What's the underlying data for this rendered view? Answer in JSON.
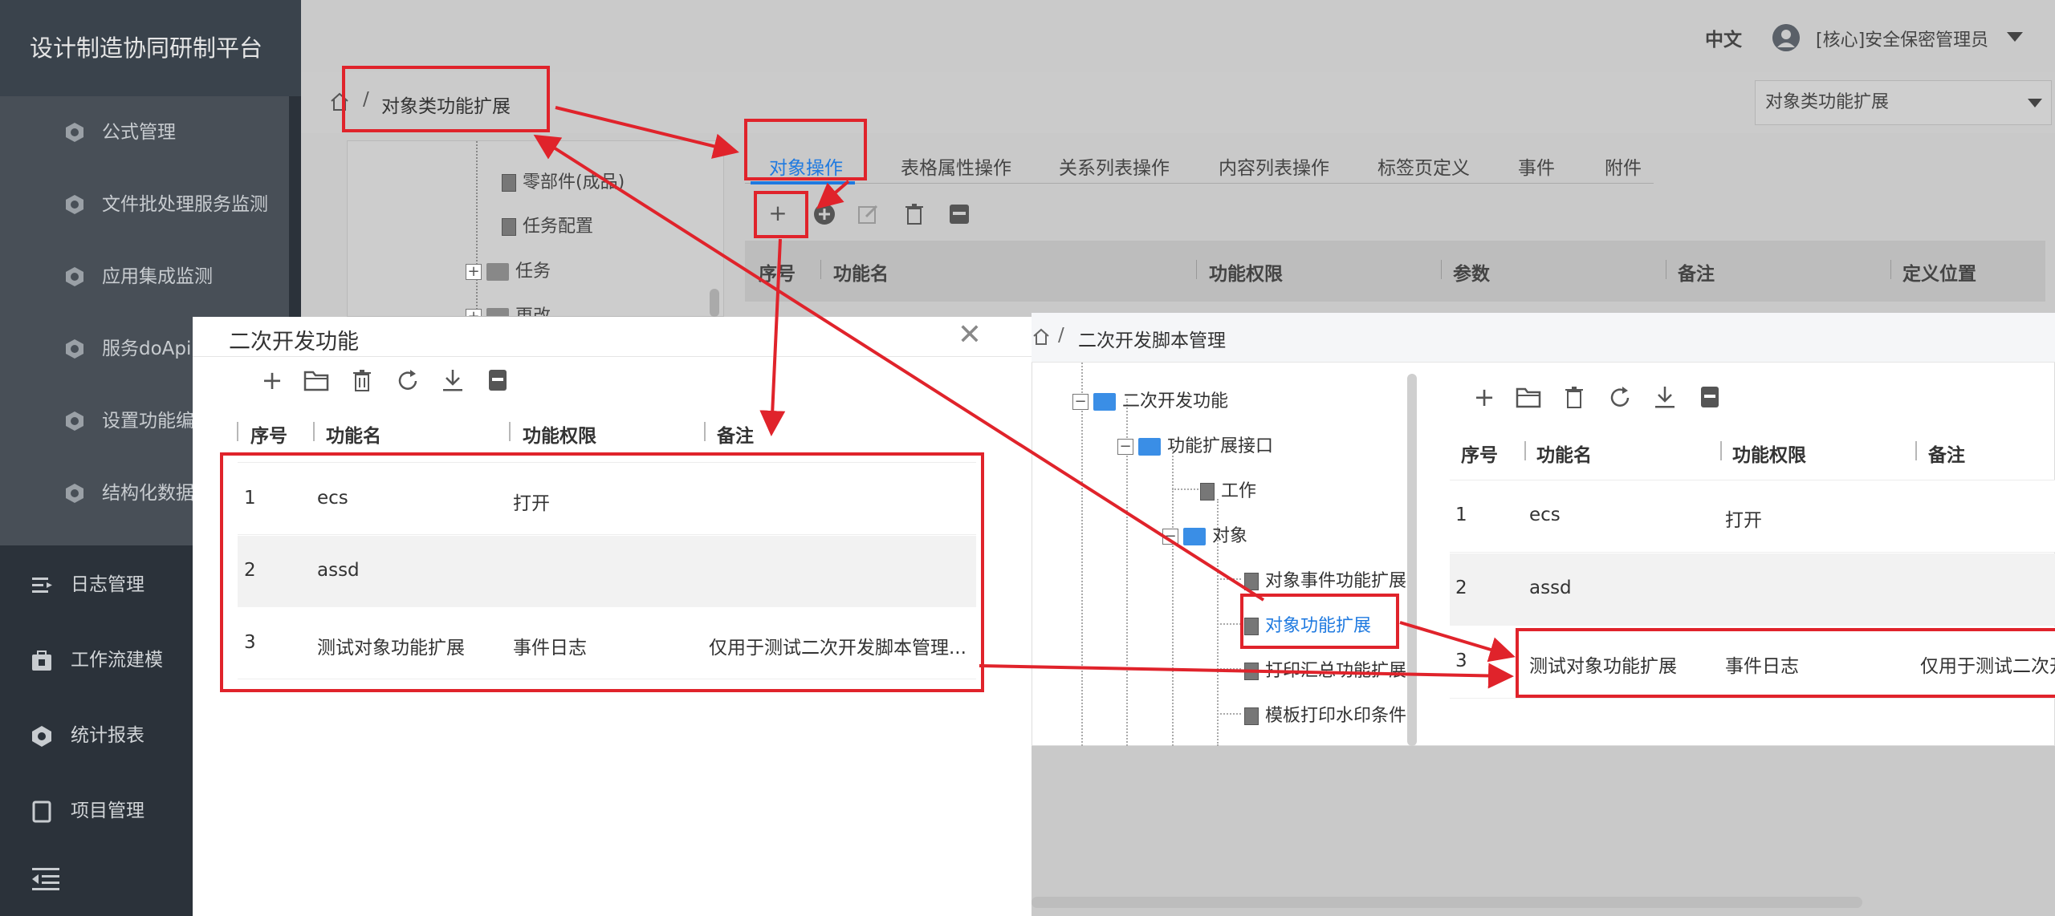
{
  "app": {
    "title": "设计制造协同研制平台"
  },
  "sidebar": {
    "sub_items": [
      {
        "label": "公式管理"
      },
      {
        "label": "文件批处理服务监测"
      },
      {
        "label": "应用集成监测"
      },
      {
        "label": "服务doApi"
      },
      {
        "label": "设置功能编"
      },
      {
        "label": "结构化数据"
      }
    ],
    "main_items": [
      {
        "label": "日志管理",
        "icon": "log-icon"
      },
      {
        "label": "工作流建模",
        "icon": "workflow-icon"
      },
      {
        "label": "统计报表",
        "icon": "report-icon"
      },
      {
        "label": "项目管理",
        "icon": "project-icon"
      }
    ]
  },
  "header": {
    "language": "中文",
    "user": "[核心]安全保密管理员"
  },
  "breadcrumb": {
    "current": "对象类功能扩展",
    "separator": "/"
  },
  "top_select": {
    "value": "对象类功能扩展"
  },
  "bg_tree": {
    "items": [
      {
        "label": "零部件(成品)",
        "type": "doc"
      },
      {
        "label": "任务配置",
        "type": "doc"
      },
      {
        "label": "任务",
        "type": "folder"
      },
      {
        "label": "更改",
        "type": "folder"
      }
    ]
  },
  "bg_tabs": [
    "对象操作",
    "表格属性操作",
    "关系列表操作",
    "内容列表操作",
    "标签页定义",
    "事件",
    "附件"
  ],
  "bg_table": {
    "headers": [
      "序号",
      "功能名",
      "功能权限",
      "参数",
      "备注",
      "定义位置"
    ]
  },
  "dialog": {
    "title": "二次开发功能",
    "headers": [
      "序号",
      "功能名",
      "功能权限",
      "备注"
    ],
    "rows": [
      {
        "no": "1",
        "name": "ecs",
        "permission": "打开",
        "remark": ""
      },
      {
        "no": "2",
        "name": "assd",
        "permission": "",
        "remark": ""
      },
      {
        "no": "3",
        "name": "测试对象功能扩展",
        "permission": "事件日志",
        "remark": "仅用于测试二次开发脚本管理..."
      }
    ]
  },
  "script_panel": {
    "breadcrumb": "二次开发脚本管理",
    "separator": "/",
    "tree": {
      "root": "二次开发功能",
      "interface": "功能扩展接口",
      "work": "工作",
      "object": "对象",
      "children": [
        "对象事件功能扩展",
        "对象功能扩展",
        "打印汇总功能扩展",
        "模板打印水印条件"
      ]
    },
    "headers": [
      "序号",
      "功能名",
      "功能权限",
      "备注"
    ],
    "rows": [
      {
        "no": "1",
        "name": "ecs",
        "permission": "打开",
        "remark": ""
      },
      {
        "no": "2",
        "name": "assd",
        "permission": "",
        "remark": ""
      },
      {
        "no": "3",
        "name": "测试对象功能扩展",
        "permission": "事件日志",
        "remark": "仅用于测试二次开"
      }
    ]
  },
  "colors": {
    "annotation_red": "#e0232b",
    "accent_blue": "#1f7ae0",
    "sidebar_dark": "#2b323a"
  }
}
